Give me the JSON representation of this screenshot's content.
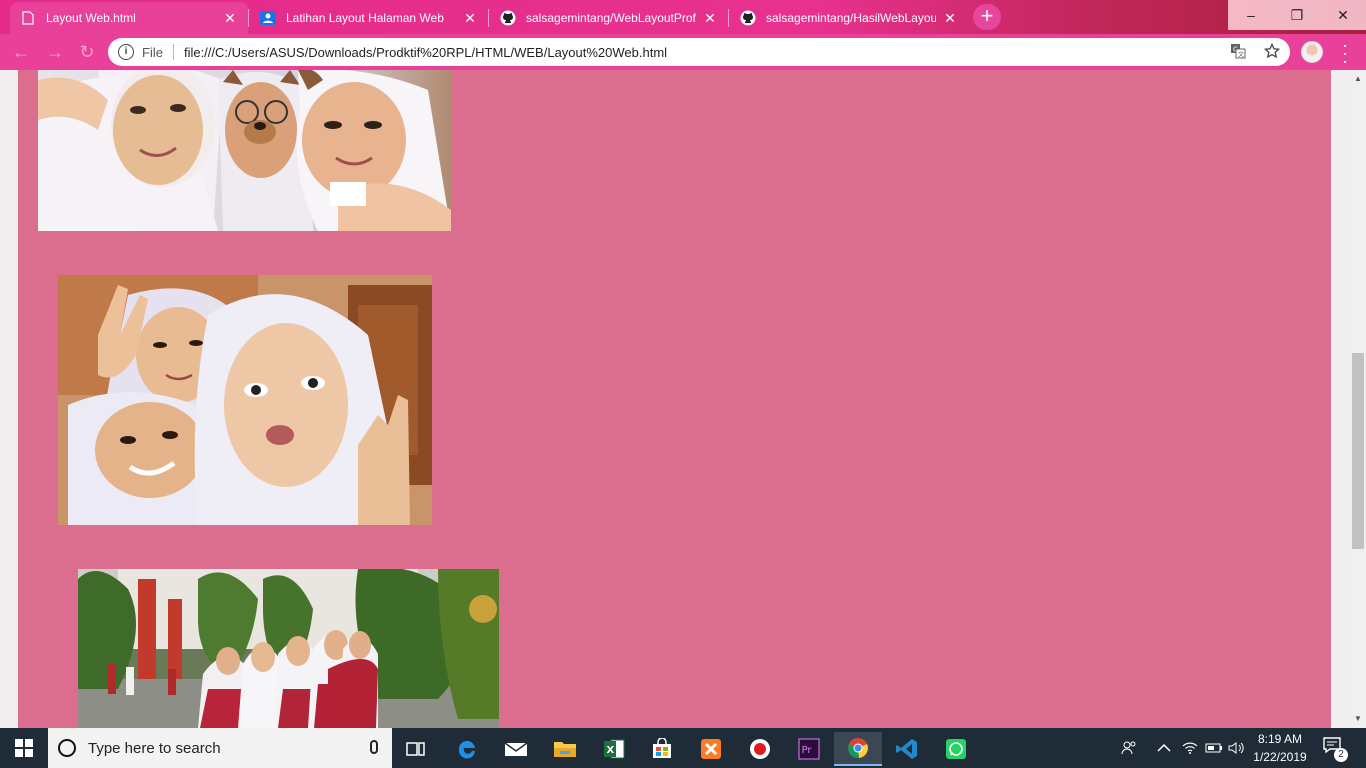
{
  "browser": {
    "tabs": [
      {
        "title": "Layout Web.html",
        "active": true,
        "icon": "file-icon"
      },
      {
        "title": "Latihan Layout Halaman Web",
        "active": false,
        "icon": "classroom-icon"
      },
      {
        "title": "salsagemintang/WebLayoutProfi",
        "active": false,
        "icon": "github-icon"
      },
      {
        "title": "salsagemintang/HasilWebLayout",
        "active": false,
        "icon": "github-icon"
      }
    ],
    "new_tab_label": "+",
    "window_controls": {
      "minimize": "–",
      "restore": "❐",
      "close": "✕"
    },
    "address": {
      "scheme_label": "File",
      "url": "file:///C:/Users/ASUS/Downloads/Prodktif%20RPL/HTML/WEB/Layout%20Web.html"
    }
  },
  "page": {
    "background": "#db6d8f",
    "photos": [
      {
        "name": "photo-three-friends-selfie"
      },
      {
        "name": "photo-group-selfie-peace-sign"
      },
      {
        "name": "photo-group-in-schoolyard"
      }
    ]
  },
  "taskbar": {
    "search_placeholder": "Type here to search",
    "apps": [
      "task-view-icon",
      "edge-icon",
      "mail-icon",
      "file-explorer-icon",
      "excel-icon",
      "store-icon",
      "xampp-icon",
      "recorder-icon",
      "premiere-icon",
      "chrome-icon",
      "vscode-icon",
      "whatsapp-icon"
    ],
    "time": "8:19 AM",
    "date": "1/22/2019",
    "notification_count": "2"
  },
  "colors": {
    "tab_strip": "#e42a8a",
    "toolbar": "#e9409a",
    "page_bg": "#db6d8f",
    "taskbar": "#1f2b36"
  }
}
